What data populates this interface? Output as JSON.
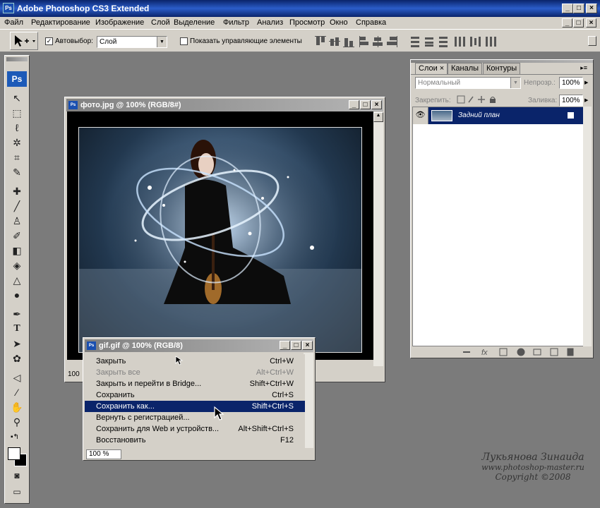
{
  "app": {
    "title": "Adobe Photoshop CS3 Extended",
    "ps_logo": "Ps"
  },
  "menu": [
    "Файл",
    "Редактирование",
    "Изображение",
    "Слой",
    "Выделение",
    "Фильтр",
    "Анализ",
    "Просмотр",
    "Окно",
    "Справка"
  ],
  "options": {
    "autoselect_label": "Автовыбор:",
    "autoselect_value": "Слой",
    "show_controls_label": "Показать управляющие элементы"
  },
  "doc_main": {
    "title": "фото.jpg @ 100% (RGB/8#)",
    "zoom": "100"
  },
  "doc_gif": {
    "title": "gif.gif @ 100% (RGB/8)",
    "zoom": "100 %"
  },
  "context_menu": [
    {
      "label": "Закрыть",
      "shortcut": "Ctrl+W",
      "disabled": false,
      "selected": false
    },
    {
      "label": "Закрыть все",
      "shortcut": "Alt+Ctrl+W",
      "disabled": true,
      "selected": false
    },
    {
      "label": "Закрыть и перейти в Bridge...",
      "shortcut": "Shift+Ctrl+W",
      "disabled": false,
      "selected": false
    },
    {
      "label": "Сохранить",
      "shortcut": "Ctrl+S",
      "disabled": false,
      "selected": false
    },
    {
      "label": "Сохранить как...",
      "shortcut": "Shift+Ctrl+S",
      "disabled": false,
      "selected": true
    },
    {
      "label": "Вернуть с регистрацией...",
      "shortcut": "",
      "disabled": false,
      "selected": false
    },
    {
      "label": "Сохранить для Web и устройств...",
      "shortcut": "Alt+Shift+Ctrl+S",
      "disabled": false,
      "selected": false
    },
    {
      "label": "Восстановить",
      "shortcut": "F12",
      "disabled": false,
      "selected": false
    }
  ],
  "layers_panel": {
    "tabs": [
      "Слои",
      "Каналы",
      "Контуры"
    ],
    "blend_mode": "Нормальный",
    "opacity_label": "Непрозр.:",
    "opacity_value": "100%",
    "lock_label": "Закрепить:",
    "fill_label": "Заливка:",
    "fill_value": "100%",
    "layer_name": "Задний план"
  },
  "watermark": {
    "name": "Лукьянова Зинаида",
    "url": "www.photoshop-master.ru",
    "copyright": "Copyright ©2008"
  },
  "colors": {
    "titlebar": "#0a246a",
    "selection": "#0a246a",
    "chrome": "#d4d0c8",
    "workspace": "#7b7b7b"
  }
}
